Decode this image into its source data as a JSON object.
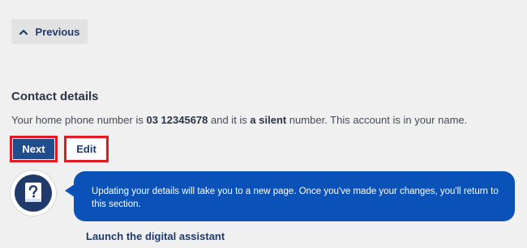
{
  "nav": {
    "previous_label": "Previous",
    "previous_icon": "chevron-up-icon"
  },
  "contact": {
    "title": "Contact details",
    "text_part1": "Your home phone number is ",
    "phone_number": "03 12345678",
    "text_part2": "  and it is ",
    "silent_label": "a silent",
    "text_part3": " number. This account is in your name."
  },
  "actions": {
    "next_label": "Next",
    "edit_label": "Edit",
    "highlight_color": "#e01b24"
  },
  "assistant": {
    "icon": "help-book-icon",
    "message": "Updating your details will take you to a new page. Once you've made your changes, you'll return to this section.",
    "launch_label": "Launch the digital assistant",
    "bubble_color": "#0a52b8"
  },
  "colors": {
    "primary": "#1f4e8c",
    "background": "#f0f0f0"
  }
}
